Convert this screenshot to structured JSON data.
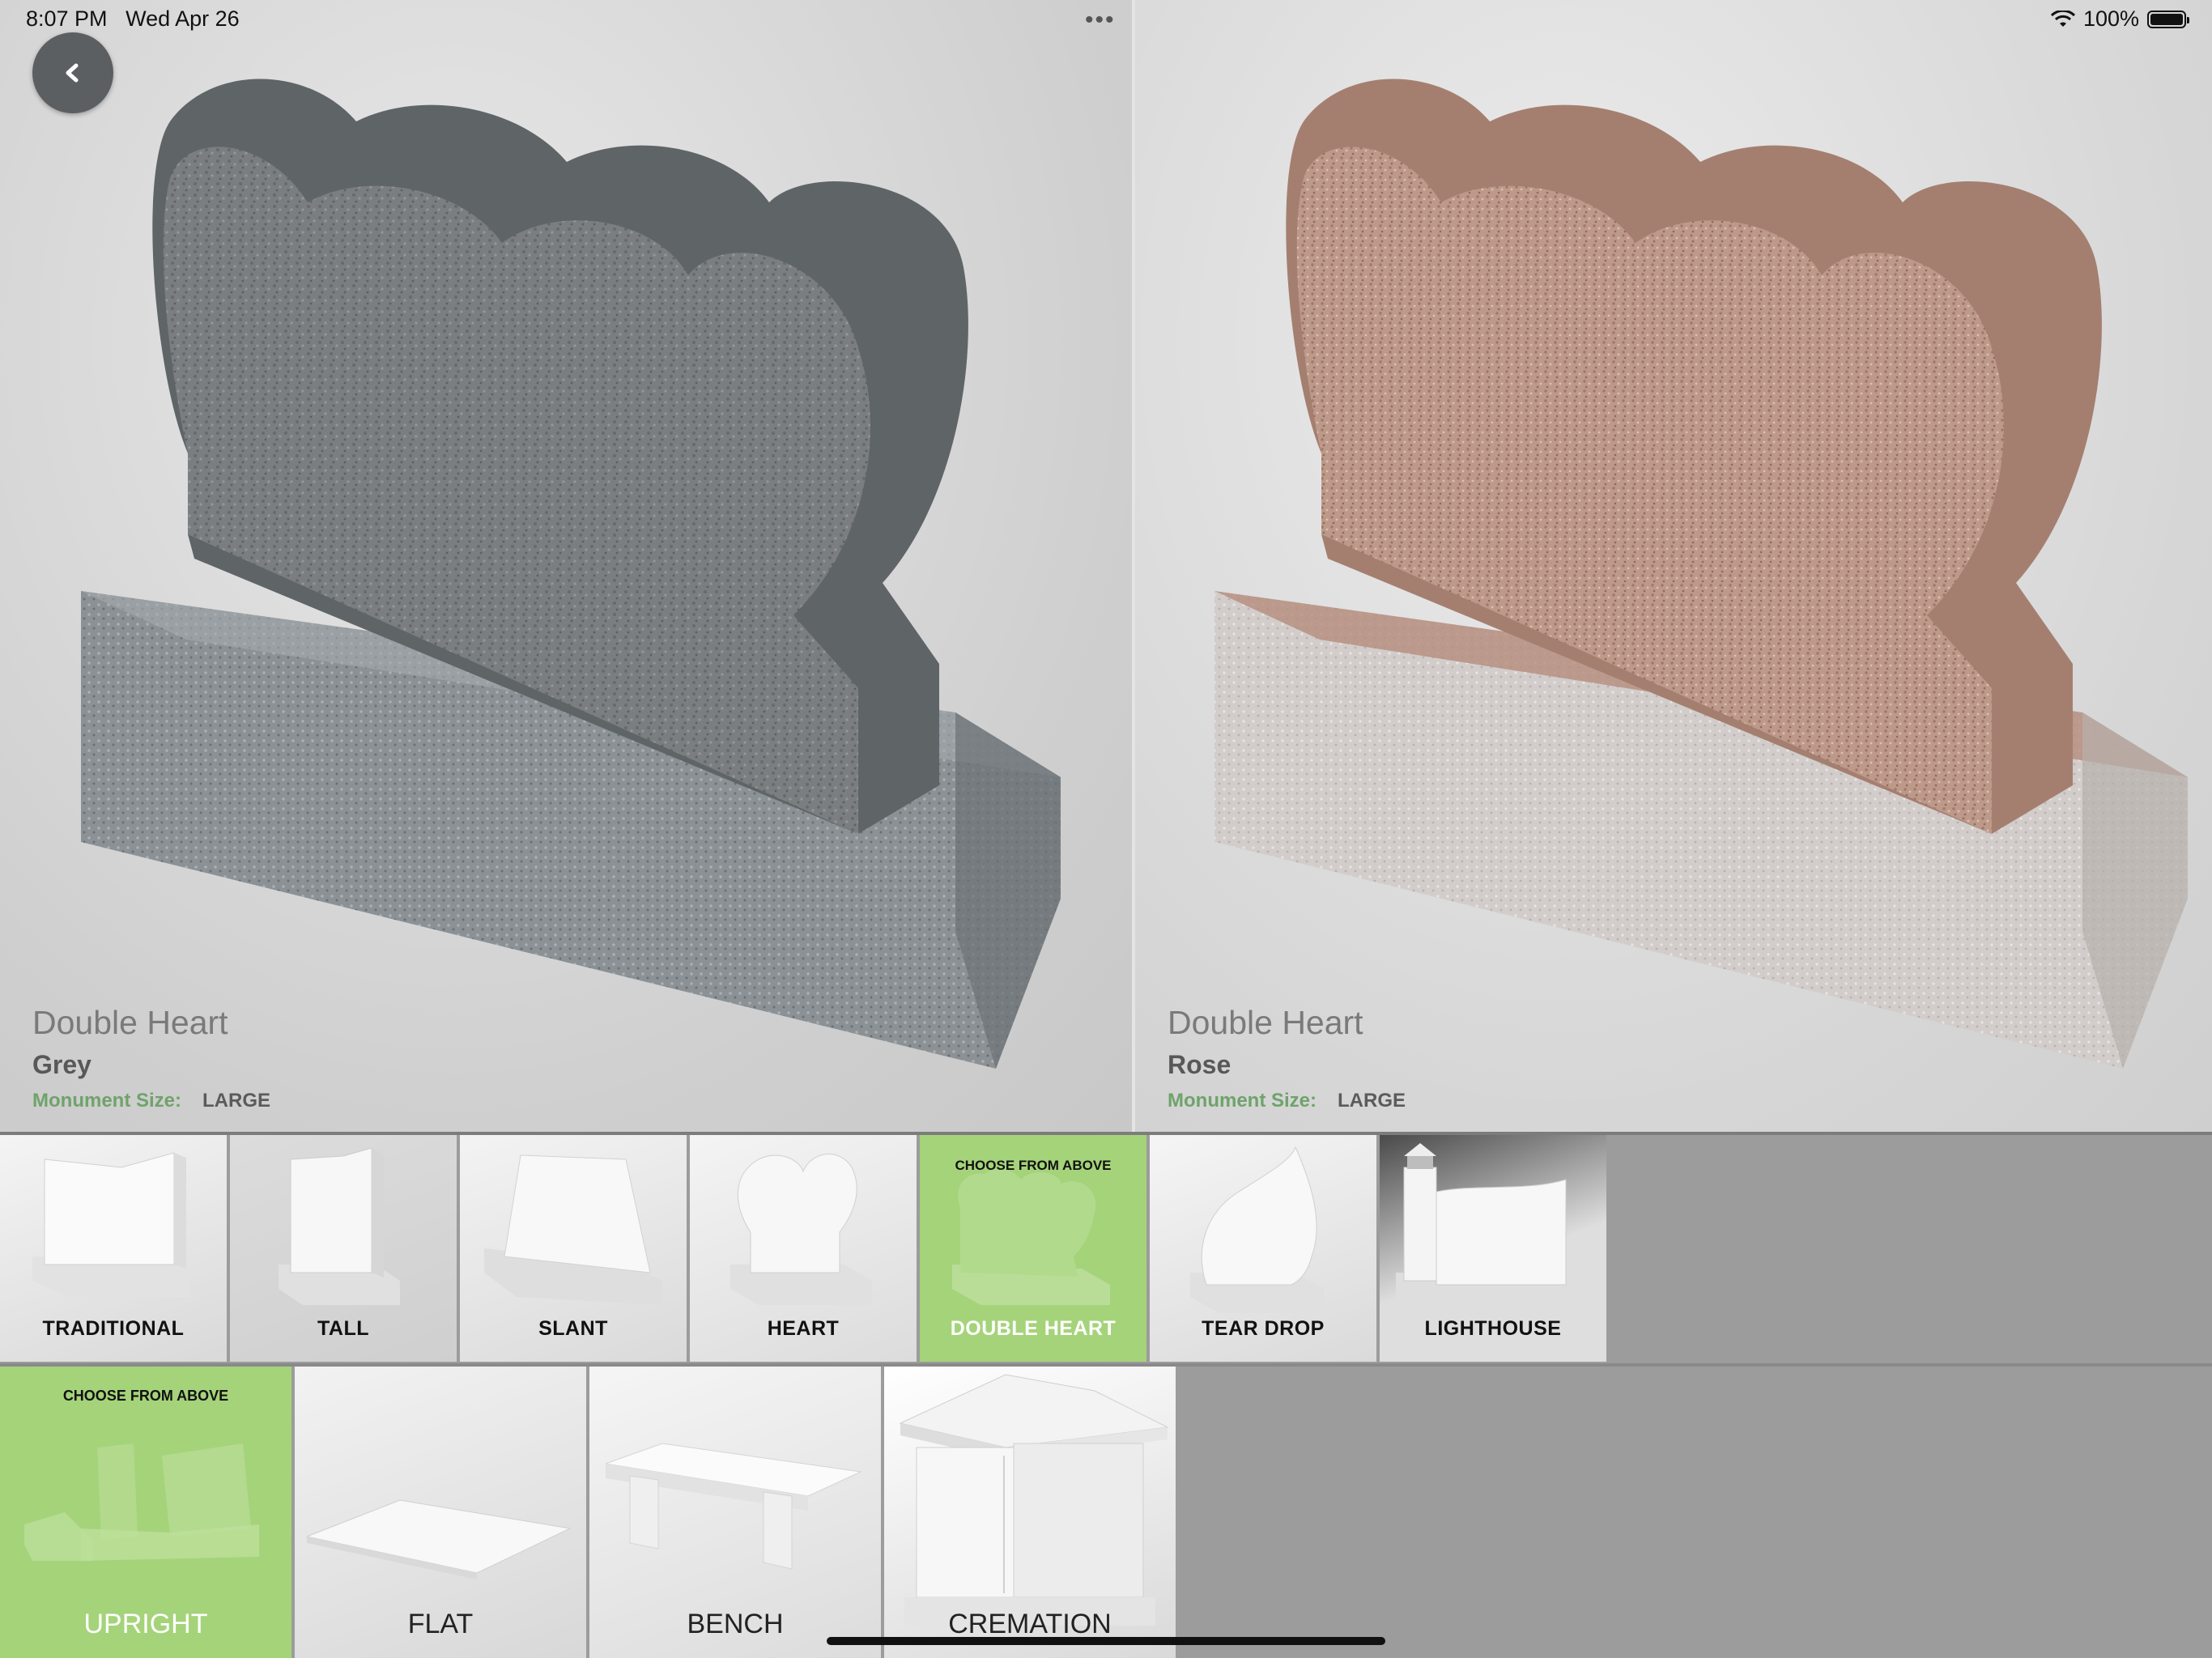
{
  "status_bar": {
    "time": "8:07 PM",
    "date": "Wed Apr 26",
    "battery": "100%",
    "battery_level": 1.0
  },
  "compare": {
    "left": {
      "name": "Double Heart",
      "color": "Grey",
      "size_label": "Monument Size:",
      "size_value": "LARGE"
    },
    "right": {
      "name": "Double Heart",
      "color": "Rose",
      "size_label": "Monument Size:",
      "size_value": "LARGE"
    }
  },
  "shape_tiles": [
    {
      "label": "TRADITIONAL",
      "selected": false
    },
    {
      "label": "TALL",
      "selected": false
    },
    {
      "label": "SLANT",
      "selected": false
    },
    {
      "label": "HEART",
      "selected": false
    },
    {
      "label": "DOUBLE HEART",
      "selected": true,
      "hint": "CHOOSE FROM ABOVE"
    },
    {
      "label": "TEAR DROP",
      "selected": false
    },
    {
      "label": "LIGHTHOUSE",
      "selected": false
    }
  ],
  "category_tiles": [
    {
      "label": "UPRIGHT",
      "selected": true,
      "hint": "CHOOSE FROM ABOVE"
    },
    {
      "label": "FLAT",
      "selected": false
    },
    {
      "label": "BENCH",
      "selected": false
    },
    {
      "label": "CREMATION",
      "selected": false
    }
  ],
  "colors": {
    "selected_tile": "#a5d37a",
    "size_label": "#6fa36b",
    "grey_granite": "#6b7072",
    "rose_granite": "#b89484"
  },
  "icons": [
    "back-icon",
    "wifi-icon",
    "battery-icon",
    "more-dots-icon"
  ]
}
